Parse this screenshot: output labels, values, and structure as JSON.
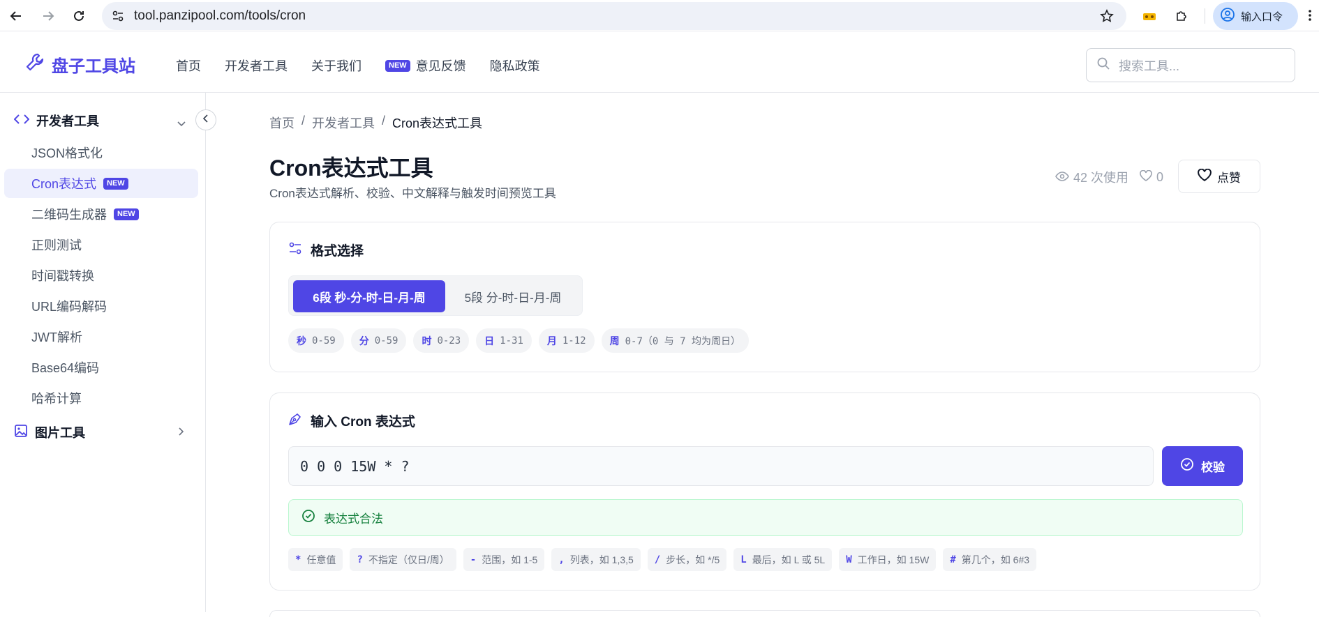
{
  "browser": {
    "url": "tool.panzipool.com/tools/cron",
    "profile_label": "输入口令"
  },
  "header": {
    "brand": "盘子工具站",
    "nav": [
      {
        "label": "首页"
      },
      {
        "label": "开发者工具"
      },
      {
        "label": "关于我们"
      },
      {
        "label": "意见反馈",
        "badge": "NEW"
      },
      {
        "label": "隐私政策"
      }
    ],
    "search_placeholder": "搜索工具..."
  },
  "sidebar": {
    "group1": "开发者工具",
    "items": [
      {
        "label": "JSON格式化"
      },
      {
        "label": "Cron表达式",
        "badge": "NEW",
        "active": true
      },
      {
        "label": "二维码生成器",
        "badge": "NEW"
      },
      {
        "label": "正则测试"
      },
      {
        "label": "时间戳转换"
      },
      {
        "label": "URL编码解码"
      },
      {
        "label": "JWT解析"
      },
      {
        "label": "Base64编码"
      },
      {
        "label": "哈希计算"
      }
    ],
    "group2": "图片工具"
  },
  "breadcrumb": [
    "首页",
    "开发者工具",
    "Cron表达式工具"
  ],
  "page": {
    "title": "Cron表达式工具",
    "subtitle": "Cron表达式解析、校验、中文解释与触发时间预览工具",
    "views": "42 次使用",
    "likes": "0",
    "like_button": "点赞"
  },
  "format_card": {
    "title": "格式选择",
    "options": [
      "6段 秒-分-时-日-月-周",
      "5段 分-时-日-月-周"
    ],
    "selected": 0,
    "fields": [
      {
        "k": "秒",
        "v": "0-59"
      },
      {
        "k": "分",
        "v": "0-59"
      },
      {
        "k": "时",
        "v": "0-23"
      },
      {
        "k": "日",
        "v": "1-31"
      },
      {
        "k": "月",
        "v": "1-12"
      },
      {
        "k": "周",
        "v": "0-7（0 与 7 均为周日）"
      }
    ]
  },
  "input_card": {
    "title": "输入 Cron 表达式",
    "value": "0 0 0 15W * ?",
    "validate_button": "校验",
    "status": "表达式合法",
    "hints": [
      {
        "k": "*",
        "v": "任意值"
      },
      {
        "k": "?",
        "v": "不指定（仅日/周）"
      },
      {
        "k": "-",
        "v": "范围，如 1-5"
      },
      {
        "k": ",",
        "v": "列表，如 1,3,5"
      },
      {
        "k": "/",
        "v": "步长，如 */5"
      },
      {
        "k": "L",
        "v": "最后，如 L 或 5L"
      },
      {
        "k": "W",
        "v": "工作日，如 15W"
      },
      {
        "k": "#",
        "v": "第几个，如 6#3"
      }
    ]
  },
  "colors": {
    "accent": "#4f46e5",
    "success": "#15803d"
  }
}
